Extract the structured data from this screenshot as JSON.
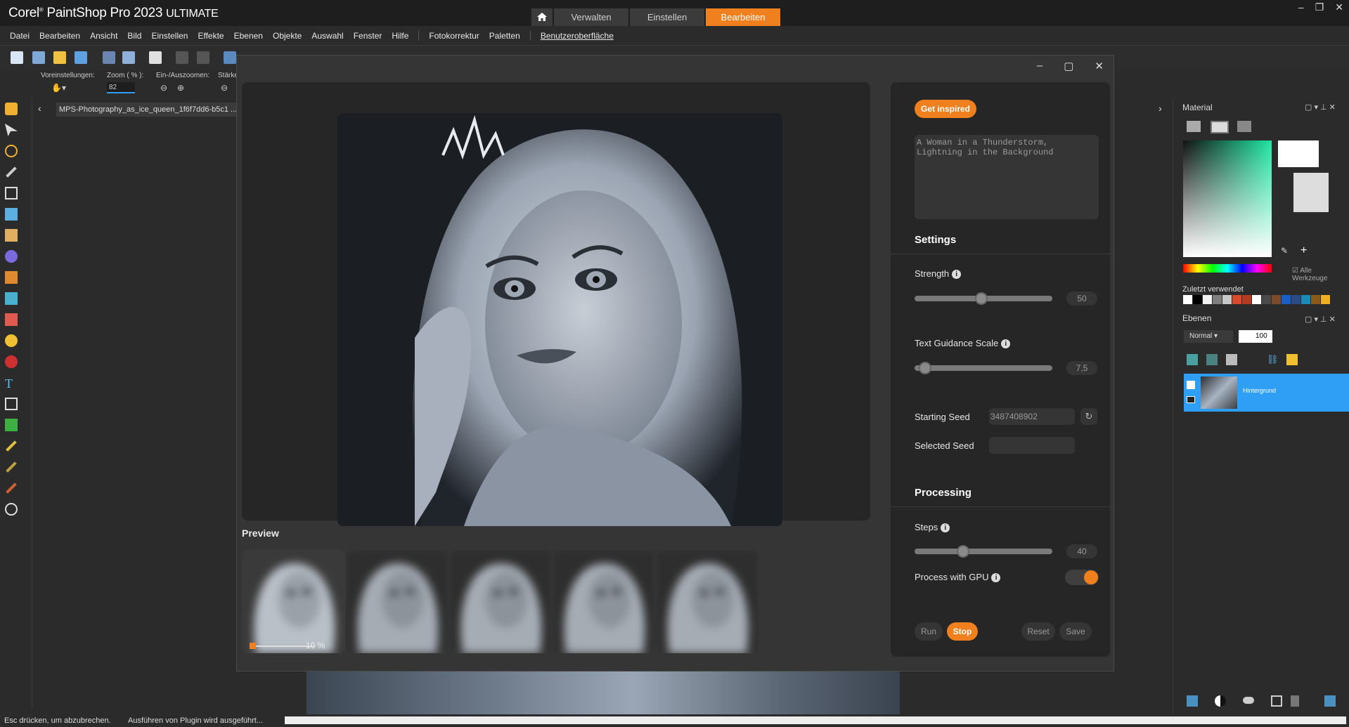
{
  "app": {
    "brand": "Corel",
    "product": "PaintShop",
    "product_suffix": "Pro 2023",
    "edition": "ULTIMATE",
    "tabs": [
      {
        "label": "Verwalten"
      },
      {
        "label": "Einstellen"
      },
      {
        "label": "Bearbeiten"
      }
    ],
    "window_controls": [
      "–",
      "❐",
      "✕"
    ]
  },
  "menu": [
    "Datei",
    "Bearbeiten",
    "Ansicht",
    "Bild",
    "Einstellen",
    "Effekte",
    "Ebenen",
    "Objekte",
    "Auswahl",
    "Fenster",
    "Hilfe",
    "Fotokorrektur",
    "Paletten",
    "Benutzeroberfläche"
  ],
  "tool_options": {
    "presets_label": "Voreinstellungen:",
    "zoom_label": "Zoom ( % ):",
    "zoom_value": "82",
    "zoom_inout_label": "Ein-/Auszoomen:",
    "strength_label": "Stärke"
  },
  "document": {
    "tab_name": "MPS-Photography_as_ice_queen_1f6f7dd6-b5c1 ..."
  },
  "plugin": {
    "preview_label": "Preview",
    "progress_text": "10 %",
    "progress_value": 0.1,
    "inspire_label": "Get inspired",
    "prompt_text": "A Woman in a Thunderstorm,\nLightning in the Background",
    "settings_title": "Settings",
    "strength_label": "Strength",
    "strength_value": "50",
    "guidance_label": "Text Guidance Scale",
    "guidance_value": "7,5",
    "starting_seed_label": "Starting Seed",
    "starting_seed_value": "3487408902",
    "selected_seed_label": "Selected Seed",
    "selected_seed_value": "",
    "processing_title": "Processing",
    "steps_label": "Steps",
    "steps_value": "40",
    "gpu_label": "Process with GPU",
    "gpu_enabled": true,
    "buttons": {
      "run": "Run",
      "stop": "Stop",
      "reset": "Reset",
      "save": "Save"
    }
  },
  "panels": {
    "material_title": "Material",
    "all_tools_label": "Alle Werkzeuge",
    "recent_label": "Zuletzt verwendet",
    "recent_colors": [
      "#ffffff",
      "#000000",
      "#f2f2f2",
      "#7f7f7f",
      "#c8c8c8",
      "#d94a2a",
      "#b53a21",
      "#ffffff",
      "#4a4a4a",
      "#7a4a2a",
      "#1a5fc8",
      "#2a4a8a",
      "#1a8ab8",
      "#8a5a1a",
      "#f0b020"
    ],
    "layers_title": "Ebenen",
    "blend_mode": "Normal",
    "opacity": "100",
    "layer_name": "Hintergrund"
  },
  "status": {
    "left": "Esc drücken, um abzubrechen.",
    "right": "Ausführen von Plugin wird ausgeführt..."
  },
  "colors": {
    "accent": "#f07f1e",
    "layer_selected": "#2f9ff5"
  }
}
